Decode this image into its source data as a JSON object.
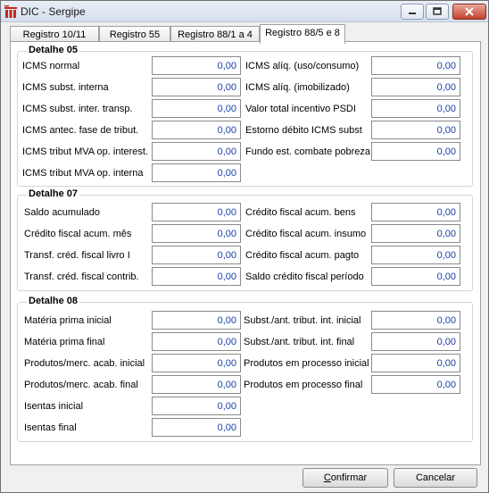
{
  "window": {
    "title": "DIC - Sergipe"
  },
  "tabs": [
    "Registro 10/11",
    "Registro 55",
    "Registro 88/1 a 4",
    "Registro 88/5 e 8"
  ],
  "groups": {
    "d05": "Detalhe 05",
    "d07": "Detalhe 07",
    "d08": "Detalhe 08"
  },
  "fields": {
    "d05_left": [
      {
        "label": "ICMS normal",
        "value": "0,00"
      },
      {
        "label": "ICMS subst. interna",
        "value": "0,00"
      },
      {
        "label": "ICMS subst. inter. transp.",
        "value": "0,00"
      },
      {
        "label": "ICMS antec. fase de tribut.",
        "value": "0,00"
      },
      {
        "label": "ICMS tribut MVA op. interest.",
        "value": "0,00"
      },
      {
        "label": "ICMS tribut MVA op. interna",
        "value": "0,00"
      }
    ],
    "d05_right": [
      {
        "label": "ICMS alíq. (uso/consumo)",
        "value": "0,00"
      },
      {
        "label": "ICMS alíq. (imobilizado)",
        "value": "0,00"
      },
      {
        "label": "Valor total incentivo PSDI",
        "value": "0,00"
      },
      {
        "label": "Estorno débito ICMS subst",
        "value": "0,00"
      },
      {
        "label": "Fundo est. combate pobreza",
        "value": "0,00"
      }
    ],
    "d07_left": [
      {
        "label": "Saldo acumulado",
        "value": "0,00"
      },
      {
        "label": "Crédito fiscal acum. mês",
        "value": "0,00"
      },
      {
        "label": "Transf. créd. fiscal livro I",
        "value": "0,00"
      },
      {
        "label": "Transf. créd. fiscal contrib.",
        "value": "0,00"
      }
    ],
    "d07_right": [
      {
        "label": "Crédito fiscal acum. bens",
        "value": "0,00"
      },
      {
        "label": "Crédito fiscal acum. insumo",
        "value": "0,00"
      },
      {
        "label": "Crédito fiscal acum. pagto",
        "value": "0,00"
      },
      {
        "label": "Saldo crédito fiscal período",
        "value": "0,00"
      }
    ],
    "d08_left": [
      {
        "label": "Matéria prima inicial",
        "value": "0,00"
      },
      {
        "label": "Matéria prima final",
        "value": "0,00"
      },
      {
        "label": "Produtos/merc. acab. inicial",
        "value": "0,00"
      },
      {
        "label": "Produtos/merc. acab. final",
        "value": "0,00"
      },
      {
        "label": "Isentas inicial",
        "value": "0,00"
      },
      {
        "label": "Isentas final",
        "value": "0,00"
      }
    ],
    "d08_right": [
      {
        "label": "Subst./ant. tribut. int. inicial",
        "value": "0,00"
      },
      {
        "label": "Subst./ant. tribut. int. final",
        "value": "0,00"
      },
      {
        "label": "Produtos em processo inicial",
        "value": "0,00"
      },
      {
        "label": "Produtos em processo final",
        "value": "0,00"
      }
    ]
  },
  "buttons": {
    "confirm_first": "C",
    "confirm_rest": "onfirmar",
    "cancel": "Cancelar"
  }
}
